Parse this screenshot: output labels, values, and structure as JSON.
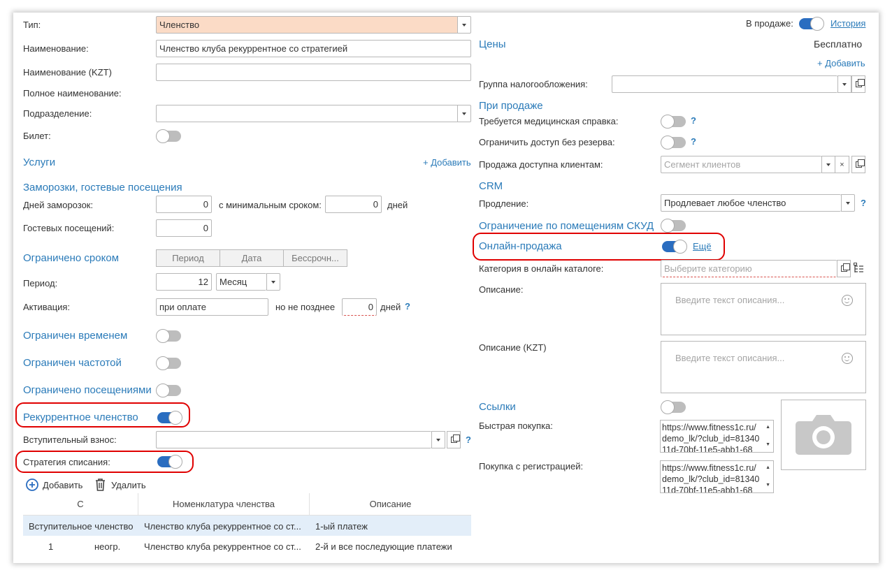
{
  "left": {
    "type": {
      "label": "Тип:",
      "value": "Членство"
    },
    "name": {
      "label": "Наименование:",
      "value": "Членство клуба рекуррентное со стратегией"
    },
    "name_kzt": {
      "label": "Наименование (KZT)",
      "value": ""
    },
    "full_name": {
      "label": "Полное наименование:"
    },
    "division": {
      "label": "Подразделение:",
      "value": ""
    },
    "ticket": {
      "label": "Билет:",
      "on": false
    },
    "services": {
      "title": "Услуги",
      "add": "+ Добавить"
    },
    "freezes": {
      "title": "Заморозки, гостевые посещения",
      "days_label": "Дней заморозок:",
      "days_value": "0",
      "min_label": "с минимальным сроком:",
      "min_value": "0",
      "days_unit": "дней",
      "guest_label": "Гостевых посещений:",
      "guest_value": "0"
    },
    "limited_term": {
      "title": "Ограничено сроком",
      "options": [
        "Период",
        "Дата",
        "Бессрочн..."
      ]
    },
    "period": {
      "label": "Период:",
      "value": "12",
      "unit": "Месяц"
    },
    "activation": {
      "label": "Активация:",
      "value": "при оплате",
      "not_later": "но не позднее",
      "days_value": "0",
      "days_unit": "дней",
      "help": "?"
    },
    "limited_time": {
      "title": "Ограничен временем",
      "on": false
    },
    "limited_freq": {
      "title": "Ограничен частотой",
      "on": false
    },
    "limited_visits": {
      "title": "Ограничено посещениями",
      "on": false
    },
    "recurrent": {
      "title": "Рекуррентное членство",
      "on": true
    },
    "entry_fee": {
      "label": "Вступительный взнос:",
      "value": "",
      "help": "?"
    },
    "strategy": {
      "label": "Стратегия списания:",
      "on": true
    },
    "toolbar": {
      "add": "Добавить",
      "delete": "Удалить"
    },
    "table": {
      "headers": [
        "С",
        "Номенклатура членства",
        "Описание"
      ],
      "rows": [
        {
          "c1": "Вступительное членство",
          "c2": "",
          "nomenclature": "Членство клуба рекуррентное со ст...",
          "description": "1-ый платеж"
        },
        {
          "c1": "1",
          "c2": "неогр.",
          "nomenclature": "Членство клуба рекуррентное со ст...",
          "description": "2-й и все последующие платежи"
        }
      ]
    }
  },
  "right": {
    "on_sale": {
      "label": "В продаже:",
      "on": true,
      "history": "История"
    },
    "prices": {
      "title": "Цены",
      "value": "Бесплатно",
      "add": "+ Добавить"
    },
    "tax_group": {
      "label": "Группа налогообложения:",
      "value": ""
    },
    "on_sale_section": {
      "title": "При продаже"
    },
    "medical": {
      "label": "Требуется медицинская справка:",
      "on": false,
      "help": "?"
    },
    "restrict": {
      "label": "Ограничить доступ без резерва:",
      "on": false,
      "help": "?"
    },
    "available": {
      "label": "Продажа доступна клиентам:",
      "placeholder": "Сегмент клиентов",
      "clear": "×"
    },
    "crm": {
      "title": "CRM"
    },
    "renewal": {
      "label": "Продление:",
      "value": "Продлевает любое членство",
      "help": "?"
    },
    "skud": {
      "title": "Ограничение по помещениям СКУД",
      "on": false
    },
    "online": {
      "title": "Онлайн-продажа",
      "on": true,
      "more": "Ещё"
    },
    "category": {
      "label": "Категория в онлайн каталоге:",
      "placeholder": "Выберите категорию"
    },
    "description": {
      "label": "Описание:",
      "placeholder": "Введите текст описания..."
    },
    "description_kzt": {
      "label": "Описание (KZT)",
      "placeholder": "Введите текст описания..."
    },
    "links": {
      "title": "Ссылки",
      "on": false
    },
    "quick_buy": {
      "label": "Быстрая покупка:",
      "value": "https://www.fitness1c.ru/demo_lk/?club_id=8134011d-70bf-11e5-abb1-68"
    },
    "reg_buy": {
      "label": "Покупка с регистрацией:",
      "value": "https://www.fitness1c.ru/demo_lk/?club_id=8134011d-70bf-11e5-abb1-68"
    }
  },
  "colors": {
    "accent": "#2b7bb9",
    "toggle_on": "#2a6dc0",
    "highlight": "#e00000",
    "type_field": "#fbdbc6"
  }
}
